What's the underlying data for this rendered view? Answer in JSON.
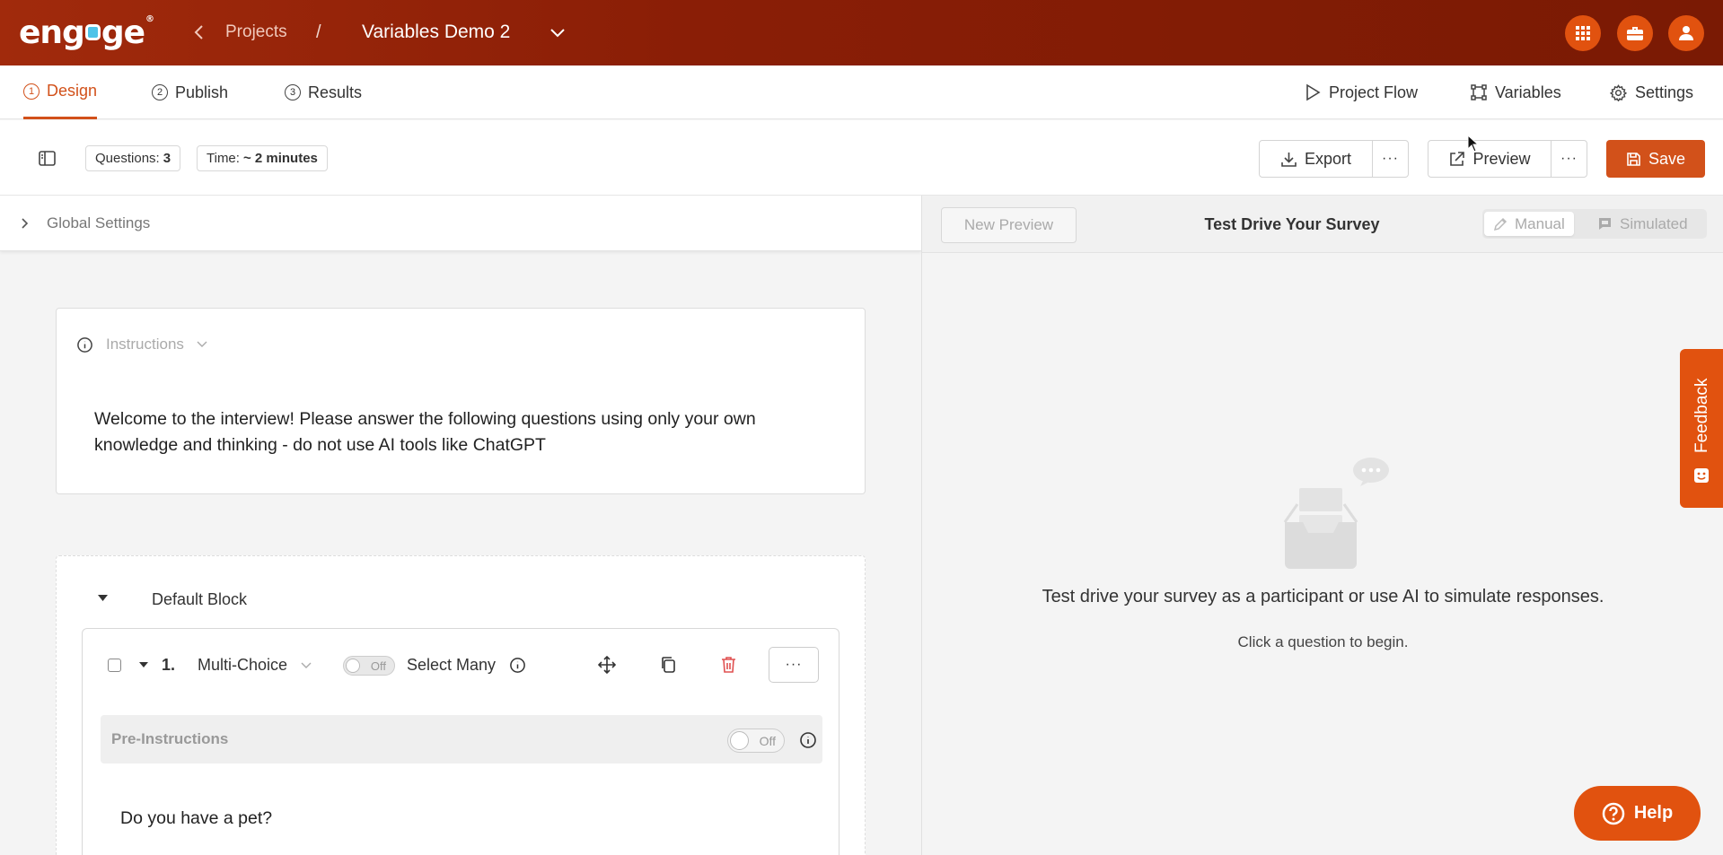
{
  "header": {
    "logo_text": "engage",
    "breadcrumb_projects": "Projects",
    "breadcrumb_sep": "/",
    "project_title": "Variables Demo 2"
  },
  "tabs": [
    {
      "num": "1",
      "label": "Design",
      "active": true
    },
    {
      "num": "2",
      "label": "Publish"
    },
    {
      "num": "3",
      "label": "Results"
    }
  ],
  "nav_links": {
    "project_flow": "Project Flow",
    "variables": "Variables",
    "settings": "Settings"
  },
  "toolbar": {
    "questions_label": "Questions:",
    "questions_value": "3",
    "time_label": "Time:",
    "time_value": "~ 2 minutes",
    "export": "Export",
    "preview": "Preview",
    "save": "Save"
  },
  "global_settings": "Global Settings",
  "instructions": {
    "heading": "Instructions",
    "text": "Welcome to the interview! Please answer the following questions using only your own knowledge and thinking - do not use AI tools like ChatGPT"
  },
  "block": {
    "title": "Default Block",
    "question": {
      "number": "1.",
      "type": "Multi-Choice",
      "select_many_toggle": "Off",
      "select_many_label": "Select Many",
      "pre_instructions_label": "Pre-Instructions",
      "pre_instructions_toggle": "Off",
      "text": "Do you have a pet?"
    }
  },
  "preview_panel": {
    "new_preview": "New Preview",
    "title": "Test Drive Your Survey",
    "mode_manual": "Manual",
    "mode_simulated": "Simulated",
    "empty_main": "Test drive your survey as a participant or use AI to simulate responses.",
    "empty_sub": "Click a question to begin."
  },
  "feedback_label": "Feedback",
  "help_label": "Help",
  "colors": {
    "brand_orange": "#d2511a",
    "header_red": "#8a1e06"
  }
}
